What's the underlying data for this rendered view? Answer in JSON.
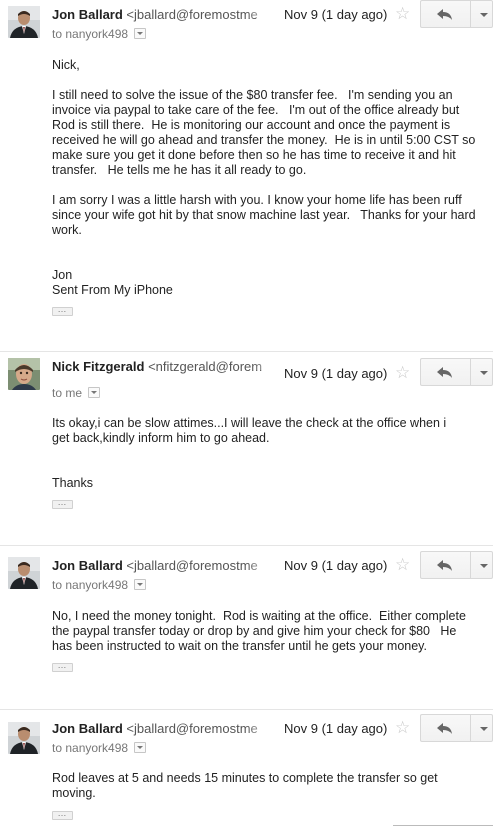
{
  "messages": [
    {
      "sender_name": "Jon Ballard",
      "sender_email": "<jballard@foremostme",
      "date": "Nov 9 (1 day ago)",
      "to": "to nanyork498",
      "avatar": "suit-man",
      "paragraphs": [
        "Nick,",
        "I still need to solve the issue of the $80 transfer fee.   I'm sending you an invoice via paypal to take care of the fee.   I'm out of the office already but Rod is still there.  He is monitoring our account and once the payment is received he will go ahead and transfer the money.  He is in until 5:00 CST so make sure you get it done before then so he has time to receive it and hit transfer.   He tells me he has it all ready to go.",
        "I am sorry I was a little harsh with you. I know your home life has been ruff since your wife got hit by that snow machine last year.   Thanks for your hard work.",
        "Jon\nSent From My iPhone"
      ]
    },
    {
      "sender_name": "Nick Fitzgerald",
      "sender_email": "<nfitzgerald@forem",
      "date": "Nov 9 (1 day ago)",
      "to": "to me",
      "avatar": "man-photo",
      "paragraphs": [
        "Its okay,i can be slow attimes...I will leave the check at the office when i get back,kindly inform him to go ahead.",
        "Thanks"
      ]
    },
    {
      "sender_name": "Jon Ballard",
      "sender_email": "<jballard@foremostme",
      "date": "Nov 9 (1 day ago)",
      "to": "to nanyork498",
      "avatar": "suit-man",
      "paragraphs": [
        "No, I need the money tonight.  Rod is waiting at the office.  Either complete the paypal transfer today or drop by and give him your check for $80   He has been instructed to wait on the transfer until he gets your money."
      ]
    },
    {
      "sender_name": "Jon Ballard",
      "sender_email": "<jballard@foremostme",
      "date": "Nov 9 (1 day ago)",
      "to": "to nanyork498",
      "avatar": "suit-man",
      "paragraphs": [
        "Rod leaves at 5 and needs 15 minutes to complete the transfer so get moving."
      ]
    }
  ],
  "ui": {
    "show_trimmed_label": "…",
    "star_glyph": "☆"
  }
}
